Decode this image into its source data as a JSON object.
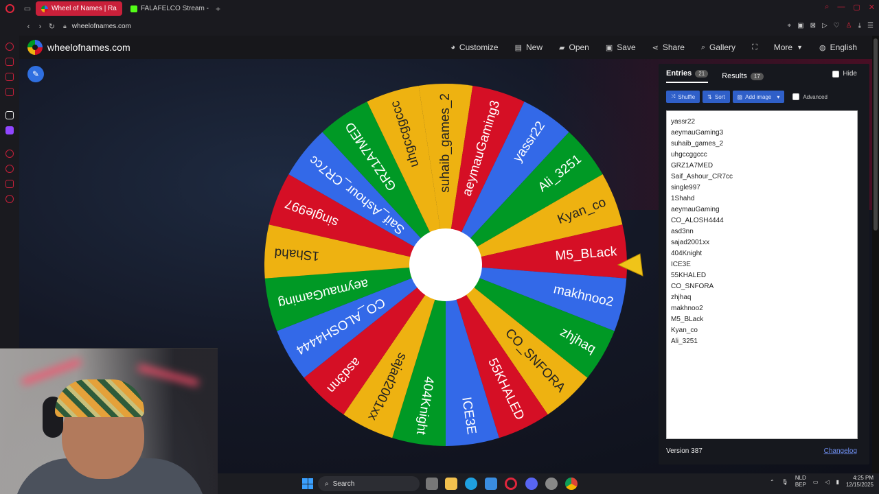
{
  "browser": {
    "tabs": [
      {
        "title": "Wheel of Names | Ra",
        "active": true
      },
      {
        "title": "FALAFELCO Stream - Wa",
        "active": false
      }
    ],
    "url": "wheelofnames.com"
  },
  "site": {
    "name": "wheelofnames.com",
    "menu": [
      {
        "label": "Customize",
        "icon": "palette-icon"
      },
      {
        "label": "New",
        "icon": "file-icon"
      },
      {
        "label": "Open",
        "icon": "folder-icon"
      },
      {
        "label": "Save",
        "icon": "save-icon"
      },
      {
        "label": "Share",
        "icon": "share-icon"
      },
      {
        "label": "Gallery",
        "icon": "search-icon"
      },
      {
        "label": "",
        "icon": "fullscreen-icon"
      },
      {
        "label": "More",
        "icon": "chevron-down-icon"
      },
      {
        "label": "English",
        "icon": "globe-icon"
      }
    ]
  },
  "wheel": {
    "segments": [
      "suhaib_games_2",
      "aeymauGaming3",
      "yassr22",
      "Ali_3251",
      "Kyan_co",
      "M5_BLack",
      "makhnoo2",
      "zhjhaq",
      "CO_SNFORA",
      "55KHALED",
      "ICE3E",
      "404Knight",
      "sajad2001xx",
      "asd3nn",
      "CO_ALOSH4444",
      "aeymauGaming",
      "1Shahd",
      "single997",
      "Saif_Ashour_CR7cc",
      "GRZ1A7MED",
      "uhgccggccc"
    ],
    "colors": {
      "yellow": "#eeb211",
      "red": "#d50f25",
      "blue": "#3369e8",
      "green": "#009925"
    }
  },
  "panel": {
    "tabs": [
      {
        "label": "Entries",
        "count": "21"
      },
      {
        "label": "Results",
        "count": "17"
      }
    ],
    "hide_label": "Hide",
    "buttons": {
      "shuffle": "Shuffle",
      "sort": "Sort",
      "add_image": "Add image",
      "advanced": "Advanced"
    },
    "entries": [
      "yassr22",
      "aeymauGaming3",
      "suhaib_games_2",
      "uhgccggccc",
      "GRZ1A7MED",
      "Saif_Ashour_CR7cc",
      "single997",
      "1Shahd",
      "aeymauGaming",
      "CO_ALOSH4444",
      "asd3nn",
      "sajad2001xx",
      "404Knight",
      "ICE3E",
      "55KHALED",
      "CO_SNFORA",
      "zhjhaq",
      "makhnoo2",
      "M5_BLack",
      "Kyan_co",
      "Ali_3251"
    ],
    "version": "Version 387",
    "changelog": "Changelog"
  },
  "taskbar": {
    "search_label": "Search",
    "lang_top": "NLD",
    "lang_bottom": "BEP",
    "time": "4:25 PM",
    "date": "12/15/2025"
  }
}
